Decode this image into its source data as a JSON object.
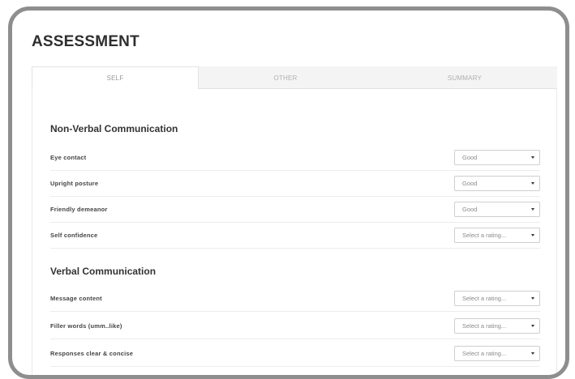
{
  "page": {
    "title": "ASSESSMENT"
  },
  "tabs": [
    {
      "label": "SELF",
      "active": true
    },
    {
      "label": "OTHER",
      "active": false
    },
    {
      "label": "SUMMARY",
      "active": false
    }
  ],
  "sections": [
    {
      "title": "Non-Verbal Communication",
      "rows": [
        {
          "label": "Eye contact",
          "value": "Good"
        },
        {
          "label": "Upright posture",
          "value": "Good"
        },
        {
          "label": "Friendly demeanor",
          "value": "Good"
        },
        {
          "label": "Self confidence",
          "value": "Select a rating..."
        }
      ]
    },
    {
      "title": "Verbal Communication",
      "rows": [
        {
          "label": "Message content",
          "value": "Select a rating..."
        },
        {
          "label": "Filler words (umm..like)",
          "value": "Select a rating..."
        },
        {
          "label": "Responses clear & concise",
          "value": "Select a rating..."
        }
      ]
    }
  ]
}
